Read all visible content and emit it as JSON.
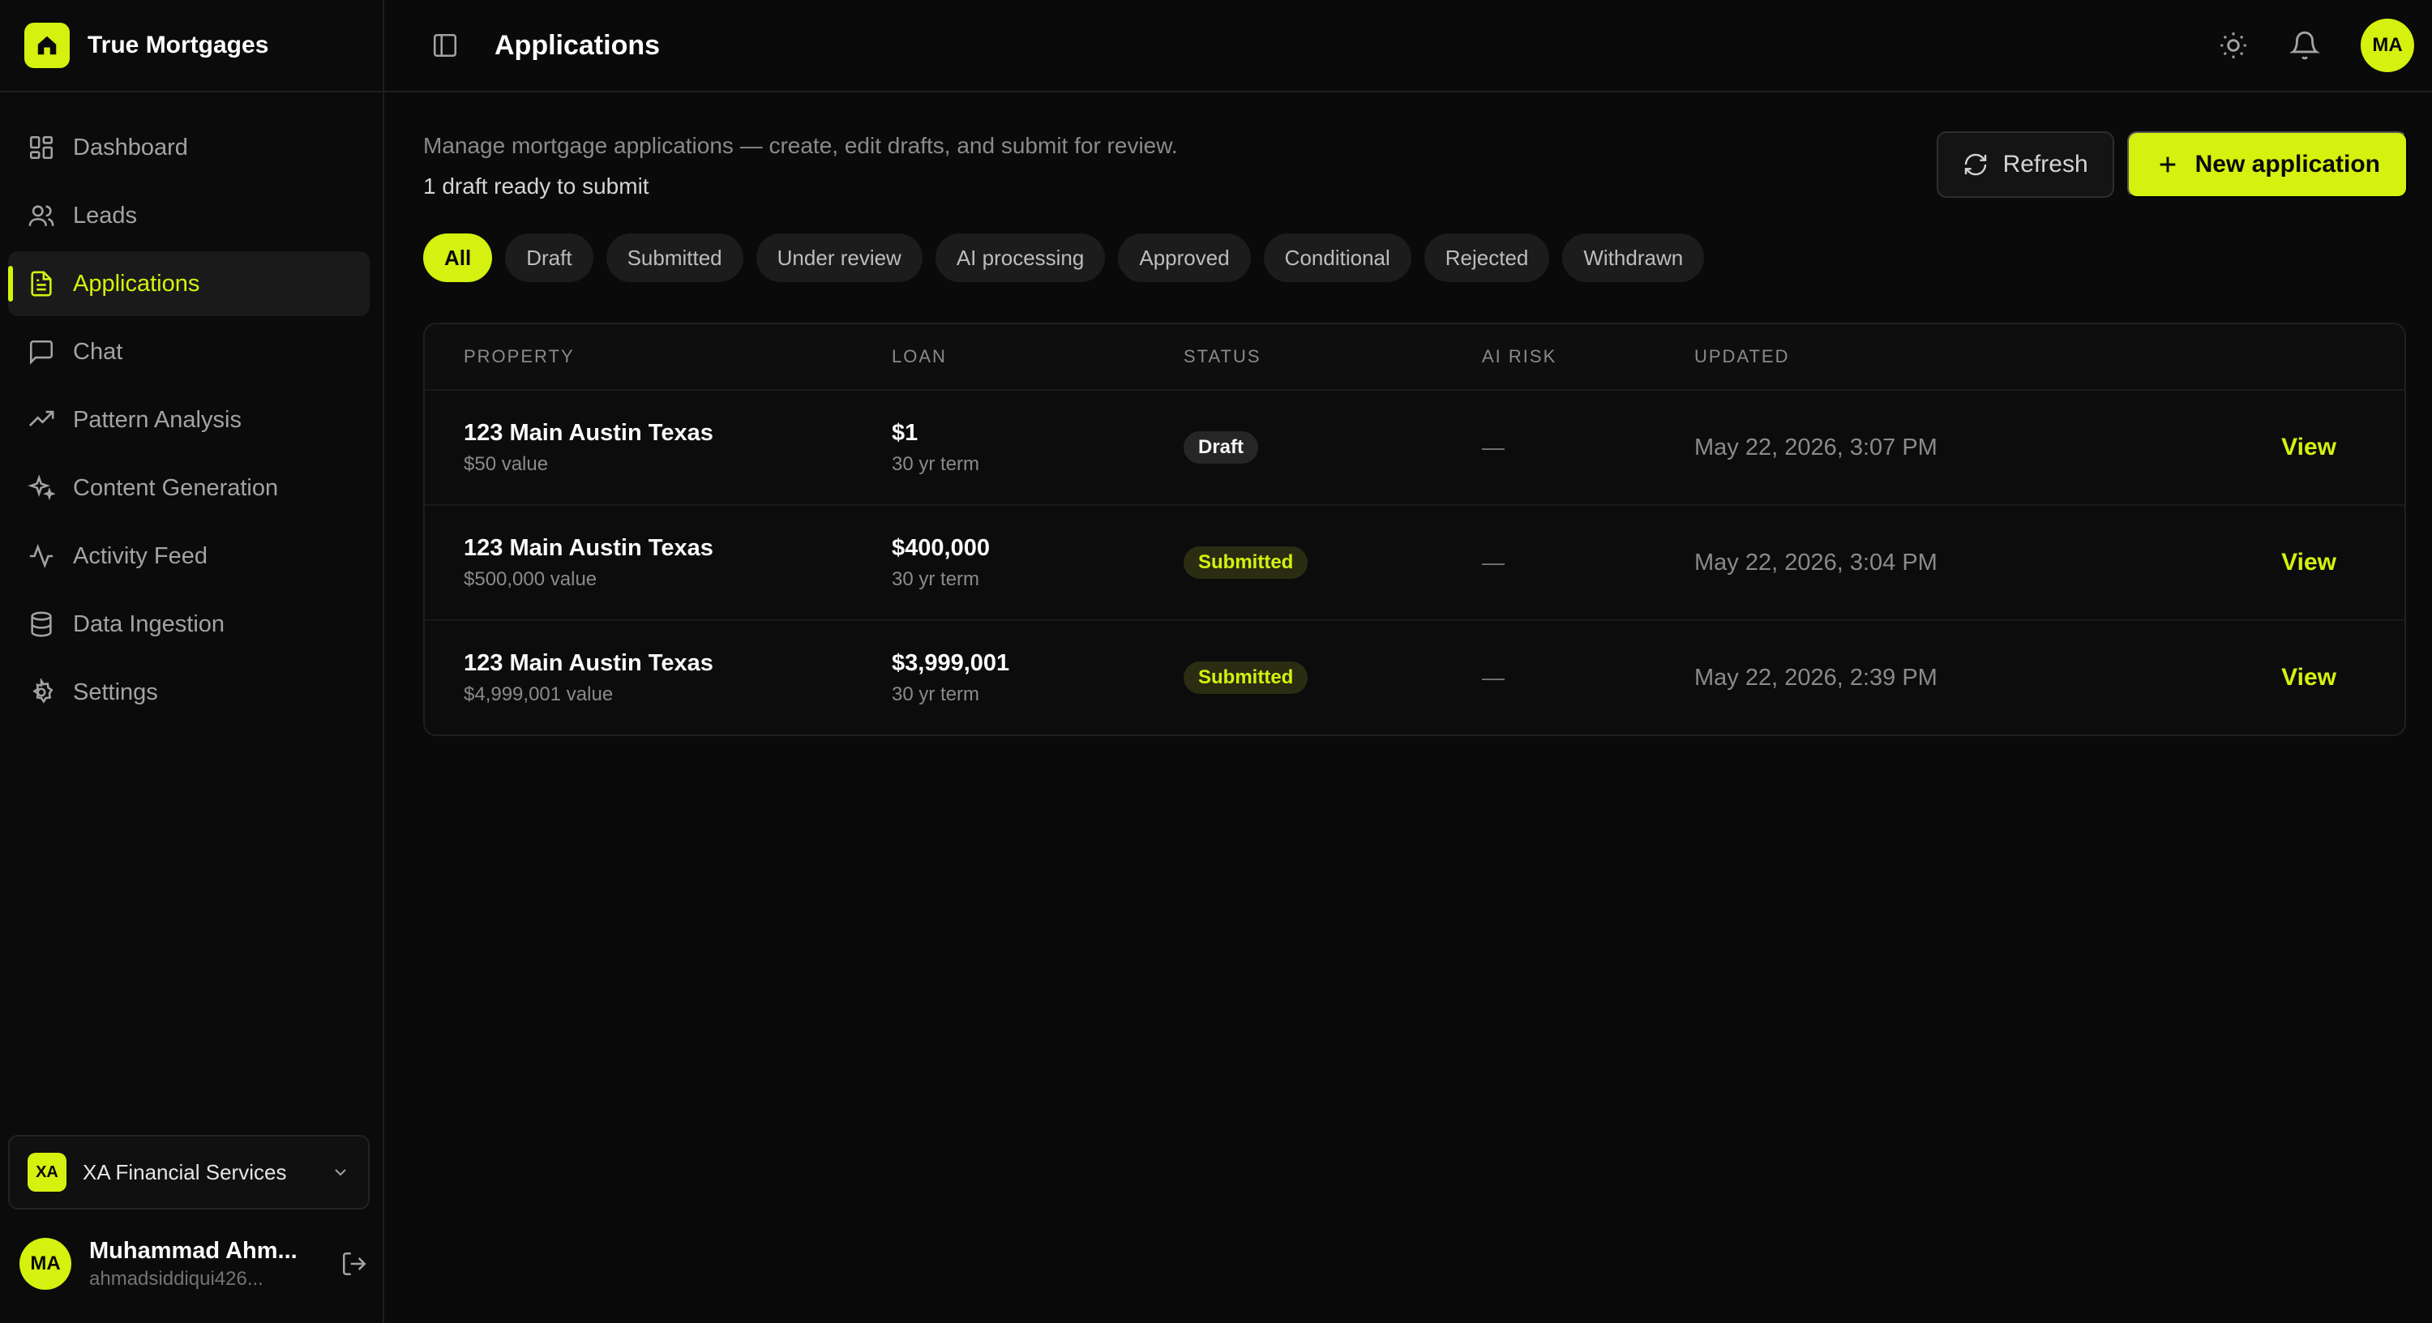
{
  "brand": {
    "name": "True Mortgages"
  },
  "sidebar": {
    "items": [
      {
        "label": "Dashboard",
        "icon": "layout-grid-icon"
      },
      {
        "label": "Leads",
        "icon": "users-icon"
      },
      {
        "label": "Applications",
        "icon": "file-text-icon",
        "active": true
      },
      {
        "label": "Chat",
        "icon": "message-square-icon"
      },
      {
        "label": "Pattern Analysis",
        "icon": "trending-up-icon"
      },
      {
        "label": "Content Generation",
        "icon": "sparkles-icon"
      },
      {
        "label": "Activity Feed",
        "icon": "activity-icon"
      },
      {
        "label": "Data Ingestion",
        "icon": "database-icon"
      },
      {
        "label": "Settings",
        "icon": "gear-icon"
      }
    ],
    "org": {
      "initials": "XA",
      "name": "XA Financial Services"
    },
    "user": {
      "initials": "MA",
      "name": "Muhammad Ahm...",
      "email": "ahmadsiddiqui426..."
    }
  },
  "header": {
    "title": "Applications",
    "avatar_initials": "MA"
  },
  "main": {
    "intro": "Manage mortgage applications — create, edit drafts, and submit for review.",
    "draft_note": "1 draft ready to submit",
    "refresh_label": "Refresh",
    "new_label": "New application",
    "filters": [
      "All",
      "Draft",
      "Submitted",
      "Under review",
      "AI processing",
      "Approved",
      "Conditional",
      "Rejected",
      "Withdrawn"
    ],
    "table": {
      "headers": {
        "property": "PROPERTY",
        "loan": "LOAN",
        "status": "STATUS",
        "risk": "AI RISK",
        "updated": "UPDATED"
      },
      "rows": [
        {
          "property": "123 Main Austin Texas",
          "value": "$50 value",
          "loan": "$1",
          "term": "30 yr term",
          "status": "Draft",
          "risk": "—",
          "updated": "May 22, 2026, 3:07 PM",
          "action": "View"
        },
        {
          "property": "123 Main Austin Texas",
          "value": "$500,000 value",
          "loan": "$400,000",
          "term": "30 yr term",
          "status": "Submitted",
          "risk": "—",
          "updated": "May 22, 2026, 3:04 PM",
          "action": "View"
        },
        {
          "property": "123 Main Austin Texas",
          "value": "$4,999,001 value",
          "loan": "$3,999,001",
          "term": "30 yr term",
          "status": "Submitted",
          "risk": "—",
          "updated": "May 22, 2026, 2:39 PM",
          "action": "View"
        }
      ]
    }
  },
  "colors": {
    "accent": "#d4f10f",
    "background": "#0a0a0a"
  }
}
